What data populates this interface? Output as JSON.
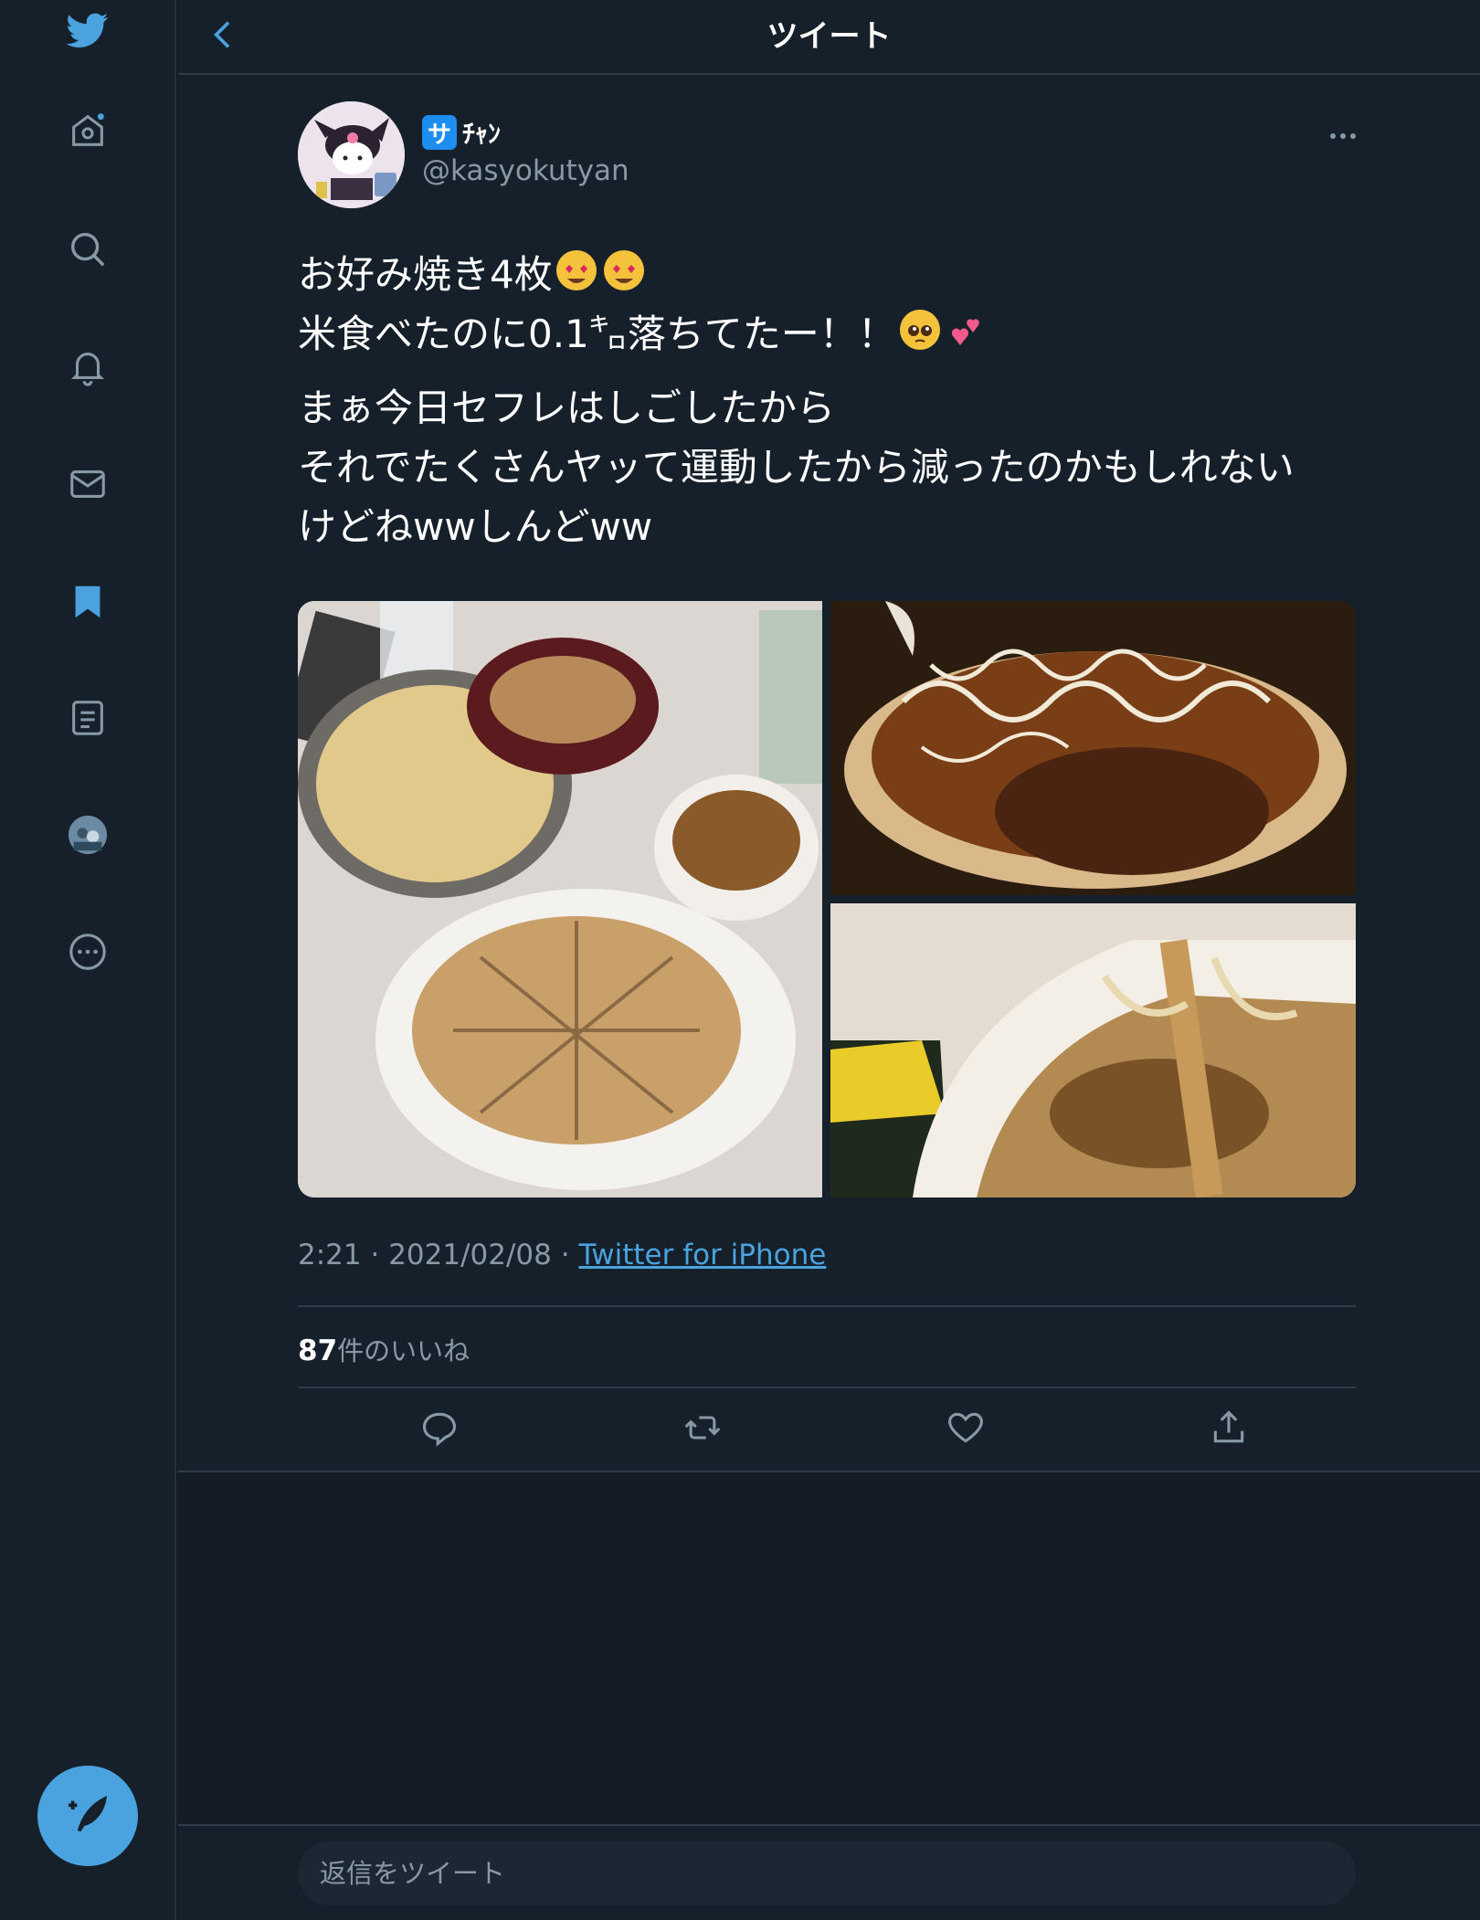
{
  "header": {
    "title": "ツイート"
  },
  "tweet": {
    "badge": "サ",
    "display_name": "ﾁｬﾝ",
    "handle": "@kasyokutyan",
    "text_lines_1": [
      "お好み焼き4枚",
      "米食べたのに0.1㌔落ちてたー！！"
    ],
    "text_lines_2": [
      "まぁ今日セフレはしごしたから",
      "それでたくさんヤッて運動したから減ったのかもしれない",
      "けどねwwしんどww"
    ],
    "emojis": [
      "heart-eyes-emoji",
      "heart-eyes-emoji",
      "pleading-face-emoji",
      "two-hearts-emoji"
    ],
    "time": "2:21",
    "date": "2021/02/08",
    "source": "Twitter for iPhone",
    "likes_count": "87",
    "likes_label": "件のいいね"
  },
  "reply": {
    "placeholder": "返信をツイート"
  },
  "colors": {
    "accent": "#4aa3df",
    "background": "#15202b",
    "muted": "#8899a6"
  }
}
